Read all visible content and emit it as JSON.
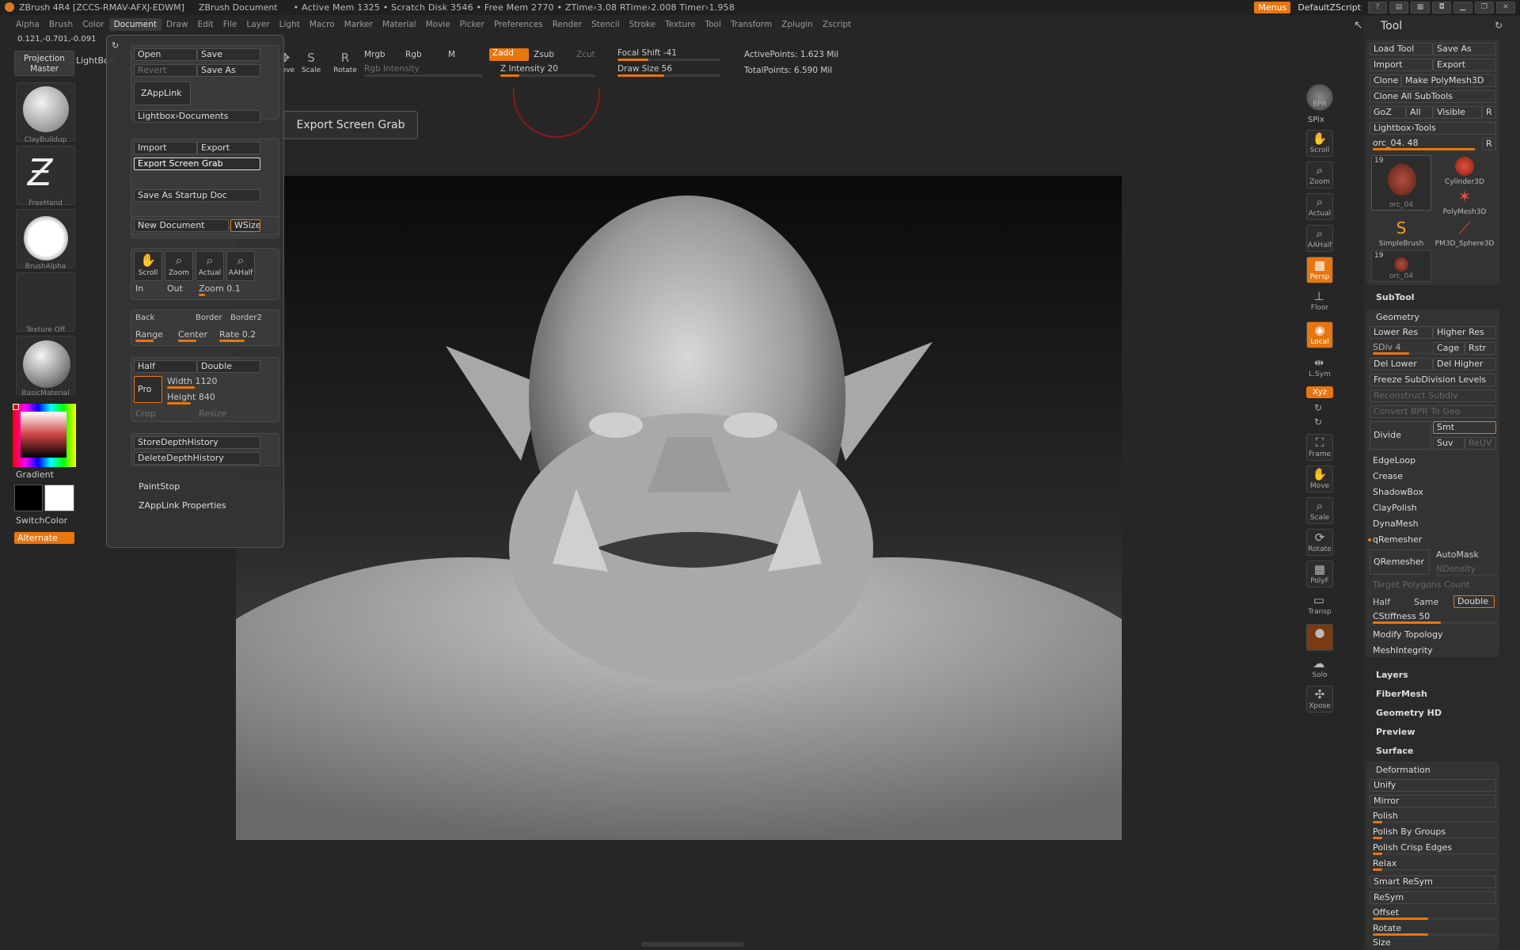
{
  "titlebar": {
    "app": "ZBrush 4R4 [ZCCS-RMAV-AFXJ-EDWM]",
    "doc": "ZBrush Document",
    "stats": "• Active Mem 1325 • Scratch Disk 3546 • Free Mem 2770 • ZTime›3.08 RTime›2.008 Timer›1.958",
    "menus": "Menus",
    "script": "DefaultZScript"
  },
  "menubar": [
    "Alpha",
    "Brush",
    "Color",
    "Document",
    "Draw",
    "Edit",
    "File",
    "Layer",
    "Light",
    "Macro",
    "Marker",
    "Material",
    "Movie",
    "Picker",
    "Preferences",
    "Render",
    "Stencil",
    "Stroke",
    "Texture",
    "Tool",
    "Transform",
    "Zplugin",
    "Zscript"
  ],
  "menubar_active": "Document",
  "coords": "0.121,-0.701,-0.091",
  "projection_master": "Projection Master",
  "lightbox": "LightBox",
  "toolbar": {
    "move": "Move",
    "scale": "Scale",
    "rotate": "Rotate",
    "mrgb": "Mrgb",
    "rgb": "Rgb",
    "m": "M",
    "zadd": "Zadd",
    "zsub": "Zsub",
    "zcut": "Zcut",
    "rgb_intensity": "Rgb Intensity",
    "z_intensity": "Z Intensity 20",
    "focal_shift": "Focal Shift -41",
    "draw_size": "Draw Size 56",
    "active_points": "ActivePoints: 1.623 Mil",
    "total_points": "TotalPoints: 6.590 Mil"
  },
  "left": {
    "brush": "ClayBuildup",
    "stroke": "FreeHand",
    "alpha": "BrushAlpha",
    "texture": "Texture Off",
    "material": "BasicMaterial",
    "gradient": "Gradient",
    "switch_color": "SwitchColor",
    "alternate": "Alternate"
  },
  "document": {
    "open": "Open",
    "save": "Save",
    "revert": "Revert",
    "save_as": "Save As",
    "zapplink": "ZAppLink",
    "lightbox_documents": "Lightbox›Documents",
    "import": "Import",
    "export": "Export",
    "export_screen_grab": "Export Screen Grab",
    "save_as_startup": "Save As Startup Doc",
    "new_document": "New Document",
    "wsize": "WSize",
    "scroll": "Scroll",
    "zoom": "Zoom",
    "actual": "Actual",
    "aahalf": "AAHalf",
    "in": "In",
    "out": "Out",
    "zoom_val": "Zoom 0.1",
    "back": "Back",
    "border": "Border",
    "border2": "Border2",
    "range": "Range",
    "center": "Center",
    "rate": "Rate 0.2",
    "half": "Half",
    "double": "Double",
    "pro": "Pro",
    "width": "Width 1120",
    "height": "Height 840",
    "crop": "Crop",
    "resize": "Resize",
    "store_depth": "StoreDepthHistory",
    "delete_depth": "DeleteDepthHistory",
    "paintstop": "PaintStop",
    "zapplink_props": "ZAppLink Properties"
  },
  "tooltip": "Export Screen Grab",
  "shelf": {
    "bpr": "BPR",
    "spix": "SPix",
    "scroll": "Scroll",
    "zoom": "Zoom",
    "actual": "Actual",
    "aahalf": "AAHalf",
    "persp": "Persp",
    "floor": "Floor",
    "local": "Local",
    "lsym": "L.Sym",
    "xyz": "Xyz",
    "frame": "Frame",
    "move": "Move",
    "scale": "Scale",
    "rotate": "Rotate",
    "polyf": "PolyF",
    "transp": "Transp",
    "solo": "Solo",
    "xpose": "Xpose"
  },
  "tool": {
    "title": "Tool",
    "load_tool": "Load Tool",
    "save_as": "Save As",
    "import": "Import",
    "export": "Export",
    "clone": "Clone",
    "make_polymesh": "Make PolyMesh3D",
    "clone_all": "Clone All SubTools",
    "goz": "GoZ",
    "all": "All",
    "visible": "Visible",
    "r": "R",
    "lightbox_tools": "Lightbox›Tools",
    "current": "orc_04. 48",
    "count": "19",
    "tools": [
      "orc_04",
      "Cylinder3D",
      "PolyMesh3D",
      "SimpleBrush",
      "PM3D_Sphere3D",
      "orc_04"
    ],
    "subtool": "SubTool",
    "geometry": "Geometry",
    "lower_res": "Lower Res",
    "higher_res": "Higher Res",
    "sdiv": "SDiv 4",
    "cage": "Cage",
    "rstr": "Rstr",
    "del_lower": "Del Lower",
    "del_higher": "Del Higher",
    "freeze": "Freeze SubDivision Levels",
    "reconstruct": "Reconstruct Subdiv",
    "convert_bpr": "Convert BPR To Geo",
    "divide": "Divide",
    "smt": "Smt",
    "suv": "Suv",
    "reuv": "ReUV",
    "edgeloop": "EdgeLoop",
    "crease": "Crease",
    "shadowbox": "ShadowBox",
    "claypolish": "ClayPolish",
    "dynamesh": "DynaMesh",
    "qremesher_h": "qRemesher",
    "qremesher": "QRemesher",
    "automask": "AutoMask",
    "ndensity": "NDensity",
    "target_poly": "Target Polygons Count",
    "half": "Half",
    "same": "Same",
    "double": "Double",
    "cstiffness": "CStiffness 50",
    "modify_topo": "Modify Topology",
    "mesh_integrity": "MeshIntegrity",
    "layers": "Layers",
    "fibermesh": "FiberMesh",
    "geometry_hd": "Geometry HD",
    "preview": "Preview",
    "surface": "Surface",
    "deformation": "Deformation",
    "unify": "Unify",
    "mirror": "Mirror",
    "polish": "Polish",
    "polish_groups": "Polish By Groups",
    "polish_crisp": "Polish Crisp Edges",
    "relax": "Relax",
    "smart_resym": "Smart ReSym",
    "resym": "ReSym",
    "offset": "Offset",
    "rotate": "Rotate",
    "size": "Size"
  },
  "colors": {
    "accent": "#e8760f",
    "panel": "#2a2a2a"
  }
}
